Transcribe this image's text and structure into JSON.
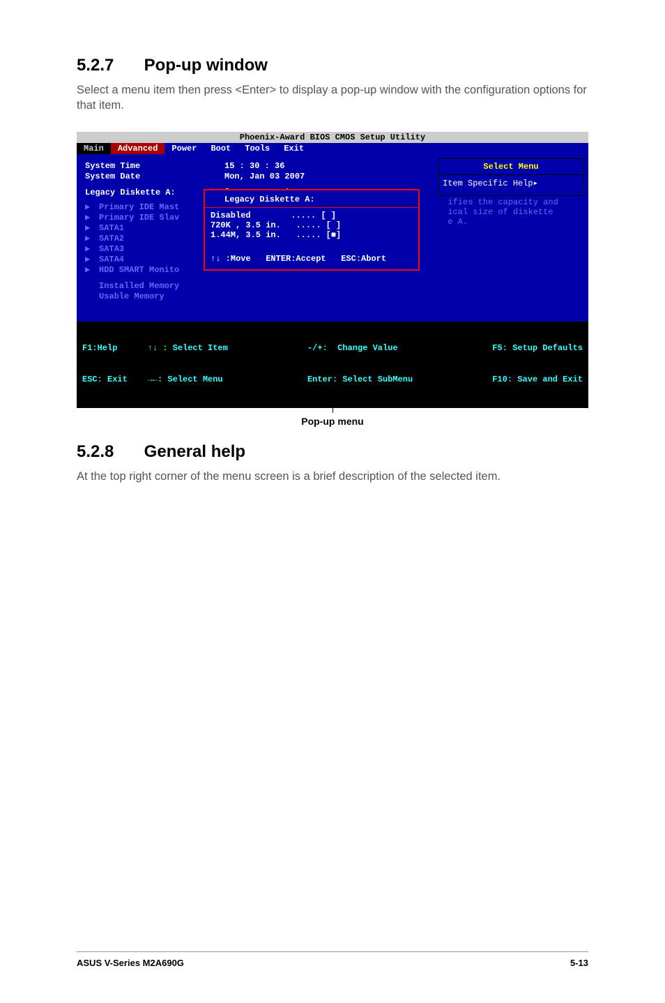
{
  "sections": {
    "popup_window": {
      "number": "5.2.7",
      "title": "Pop-up window",
      "body": "Select a menu item then press <Enter> to display a pop-up window with the configuration options for that item."
    },
    "general_help": {
      "number": "5.2.8",
      "title": "General help",
      "body": "At the top right corner of the menu screen is a brief description of the selected item."
    }
  },
  "bios": {
    "title": "Phoenix-Award BIOS CMOS Setup Utility",
    "tabs": [
      "Main",
      "Advanced",
      "Power",
      "Boot",
      "Tools",
      "Exit"
    ],
    "main": {
      "system_time_label": "System Time",
      "system_time_value": "15 : 30 : 36",
      "system_date_label": "System Date",
      "system_date_value": "Mon, Jan 03 2007",
      "legacy_diskette_label": "Legacy Diskette A:",
      "legacy_diskette_value": "[1.44M, 3.5 in.",
      "items": [
        "Primary IDE Mast",
        "Primary IDE Slav",
        "SATA1",
        "SATA2",
        "SATA3",
        "SATA4",
        "HDD SMART Monito"
      ],
      "installed_memory_label": "Installed Memory",
      "usable_memory_label": "Usable Memory"
    },
    "help_panel": {
      "select_menu": "Select Menu",
      "item_specific": "Item Specific Help▸",
      "desc": "  ifies the capacity and\n  ical size of diskette\n  e A."
    },
    "popup": {
      "title": "Legacy Diskette A:",
      "options": [
        {
          "label": "Disabled",
          "dots": ".....",
          "marker": "[ ]"
        },
        {
          "label": "720K , 3.5 in. ",
          "dots": ".....",
          "marker": "[ ]"
        },
        {
          "label": "1.44M, 3.5 in. ",
          "dots": ".....",
          "marker": "[■]"
        }
      ],
      "footer": "↑↓ :Move   ENTER:Accept   ESC:Abort"
    },
    "footer": {
      "c1a": "F1:Help      ↑↓ : Select Item",
      "c1b": "ESC: Exit    →←: Select Menu",
      "c2a": "-/+:  Change Value",
      "c2b": "Enter: Select SubMenu",
      "c3a": "F5: Setup Defaults",
      "c3b": "F10: Save and Exit"
    }
  },
  "caption": "Pop-up menu",
  "page_footer": {
    "left": "ASUS V-Series M2A690G",
    "right": "5-13"
  }
}
